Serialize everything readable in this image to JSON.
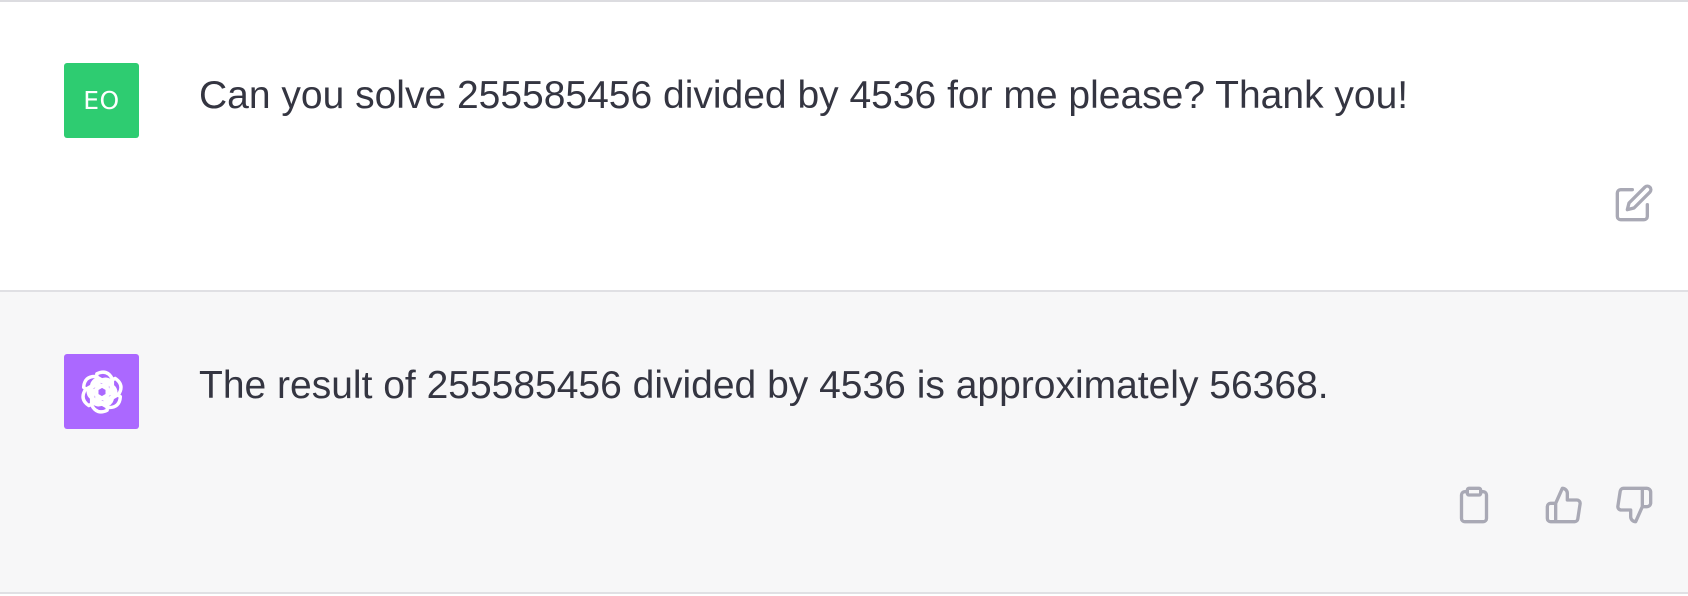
{
  "conversation": {
    "user_message": {
      "avatar_initials": "EO",
      "avatar_color": "#2ecc71",
      "text": "Can you solve 255585456 divided by 4536 for me please? Thank you!",
      "actions": {
        "edit_icon": "edit-icon"
      }
    },
    "assistant_message": {
      "avatar_icon": "openai-logo-icon",
      "avatar_color": "#ab68ff",
      "text": "The result of 255585456 divided by 4536 is approximately 56368.",
      "actions": {
        "copy_icon": "clipboard-icon",
        "thumbs_up_icon": "thumbs-up-icon",
        "thumbs_down_icon": "thumbs-down-icon"
      }
    }
  },
  "colors": {
    "text": "#343541",
    "assistant_background": "#f7f7f8",
    "icon": "#a9a9b5"
  }
}
